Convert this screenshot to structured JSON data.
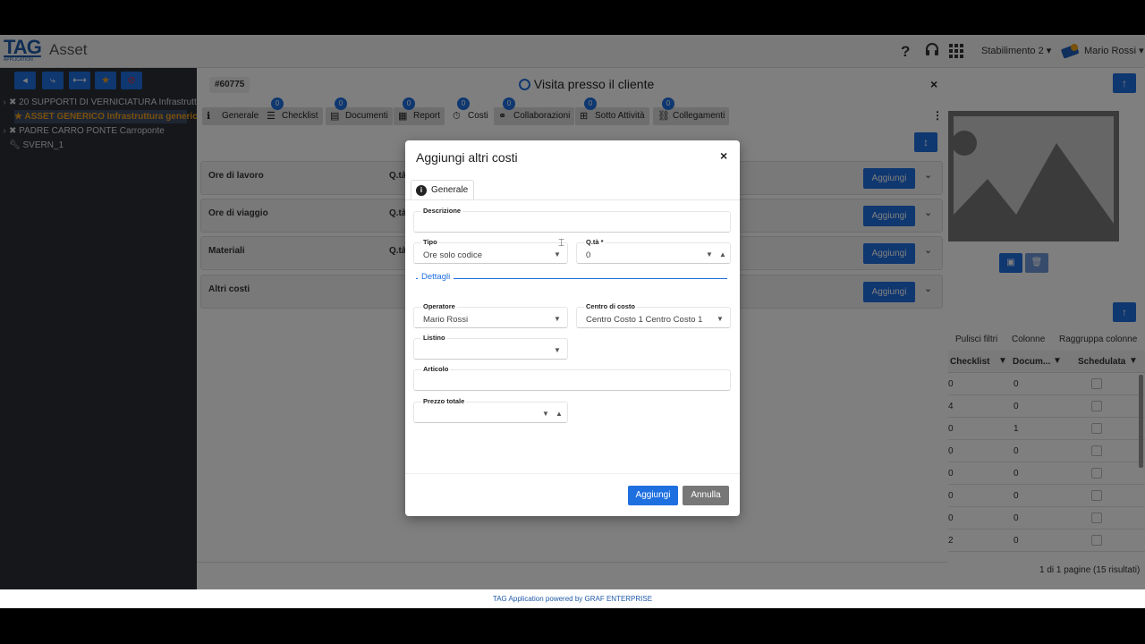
{
  "app": {
    "logo": "TAG",
    "logo_sub": "APPLICATION",
    "title": "Asset"
  },
  "topbar": {
    "help_icon": "?",
    "plant_menu": "Stabilimento 2",
    "user_menu": "Mario Rossi"
  },
  "sidebar": {
    "tree": [
      {
        "label": "20 SUPPORTI DI VERNICIATURA Infrastruttur",
        "selected": false
      },
      {
        "label": "ASSET GENERICO Infrastruttura generica",
        "selected": true
      },
      {
        "label": "PADRE CARRO PONTE Carroponte",
        "selected": false
      },
      {
        "label": "SVERN_1",
        "selected": false
      }
    ]
  },
  "panel": {
    "id": "#60775",
    "title": "Visita presso il cliente",
    "close": "×",
    "tabs": [
      {
        "label": "Generale",
        "count": ""
      },
      {
        "label": "Checklist",
        "count": "0"
      },
      {
        "label": "Documenti",
        "count": "0"
      },
      {
        "label": "Report",
        "count": "0"
      },
      {
        "label": "Costi",
        "count": "0"
      },
      {
        "label": "Collaborazioni",
        "count": "0"
      },
      {
        "label": "Sotto Attività",
        "count": "0"
      },
      {
        "label": "Collegamenti",
        "count": "0"
      }
    ],
    "sections": [
      {
        "label": "Ore di lavoro",
        "qty": "Q.tà:",
        "button": "Aggiungi"
      },
      {
        "label": "Ore di viaggio",
        "qty": "Q.tà:",
        "button": "Aggiungi"
      },
      {
        "label": "Materiali",
        "qty": "Q.tà:",
        "button": "Aggiungi"
      },
      {
        "label": "Altri costi",
        "qty": "",
        "button": "Aggiungi"
      }
    ]
  },
  "grid": {
    "toolbar": [
      "Pulisci filtri",
      "Colonne",
      "Raggruppa colonne"
    ],
    "headers": [
      "Checklist",
      "Docum...",
      "Schedulata"
    ],
    "rows": [
      [
        "0",
        "0"
      ],
      [
        "4",
        "0"
      ],
      [
        "0",
        "1"
      ],
      [
        "0",
        "0"
      ],
      [
        "0",
        "0"
      ],
      [
        "0",
        "0"
      ],
      [
        "0",
        "0"
      ],
      [
        "2",
        "0"
      ]
    ],
    "pagination": "1 di 1 pagine (15 risultati)"
  },
  "footer": "TAG Application powered by GRAF ENTERPRISE",
  "modal": {
    "title": "Aggiungi altri costi",
    "close": "×",
    "tab": "Generale",
    "fields": {
      "descrizione": {
        "label": "Descrizione",
        "value": ""
      },
      "tipo": {
        "label": "Tipo",
        "value": "Ore solo codice"
      },
      "qta": {
        "label": "Q.tà *",
        "value": "0"
      },
      "dettagli": "Dettagli",
      "operatore": {
        "label": "Operatore",
        "value": "Mario Rossi"
      },
      "centro": {
        "label": "Centro di costo",
        "value": "Centro Costo 1 Centro Costo 1"
      },
      "listino": {
        "label": "Listino",
        "value": ""
      },
      "articolo": {
        "label": "Articolo",
        "value": ""
      },
      "prezzo": {
        "label": "Prezzo totale",
        "value": ""
      }
    },
    "add_button": "Aggiungi",
    "cancel_button": "Annulla"
  }
}
